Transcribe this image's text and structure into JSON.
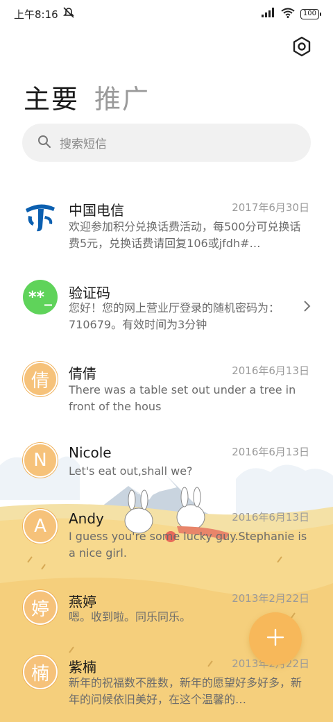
{
  "status_bar": {
    "time": "上午8:16",
    "battery": "100"
  },
  "tabs": [
    {
      "label": "主要",
      "active": true
    },
    {
      "label": "推广",
      "active": false
    }
  ],
  "search": {
    "placeholder": "搜索短信"
  },
  "conversations": [
    {
      "name": "中国电信",
      "date": "2017年6月30日",
      "snippet": "欢迎参加积分兑换话费活动，每500分可兑换话费5元，兑换话费请回复106或jfdh#…",
      "avatar": "telecom-logo"
    },
    {
      "name": "验证码",
      "date": "",
      "snippet": "您好！您的网上营业厅登录的随机密码为：710679。有效时间为3分钟",
      "avatar_text": "**_",
      "avatar": "verification-avatar"
    },
    {
      "name": "倩倩",
      "date": "2016年6月13日",
      "snippet": "There was a table set out under a tree in front of the hous",
      "avatar_text": "倩"
    },
    {
      "name": "Nicole",
      "date": "2016年6月13日",
      "snippet": "Let's eat out,shall we?",
      "avatar_text": "N"
    },
    {
      "name": "Andy",
      "date": "2016年6月13日",
      "snippet": "I guess you're some lucky guy.Stephanie is a nice girl.",
      "avatar_text": "A"
    },
    {
      "name": "燕婷",
      "date": "2013年2月22日",
      "snippet": "嗯。收到啦。同乐同乐。",
      "avatar_text": "婷"
    },
    {
      "name": "紫楠",
      "date": "2013年2月22日",
      "snippet": "新年的祝福数不胜数，新年的愿望好多好多，新年的问候依旧美好，在这个温馨的…",
      "avatar_text": "楠"
    }
  ],
  "colors": {
    "accent": "#f7b85a",
    "avatar_orange": "#f6c27a",
    "avatar_green": "#5fd35a",
    "telecom_blue": "#0b5fb0"
  }
}
